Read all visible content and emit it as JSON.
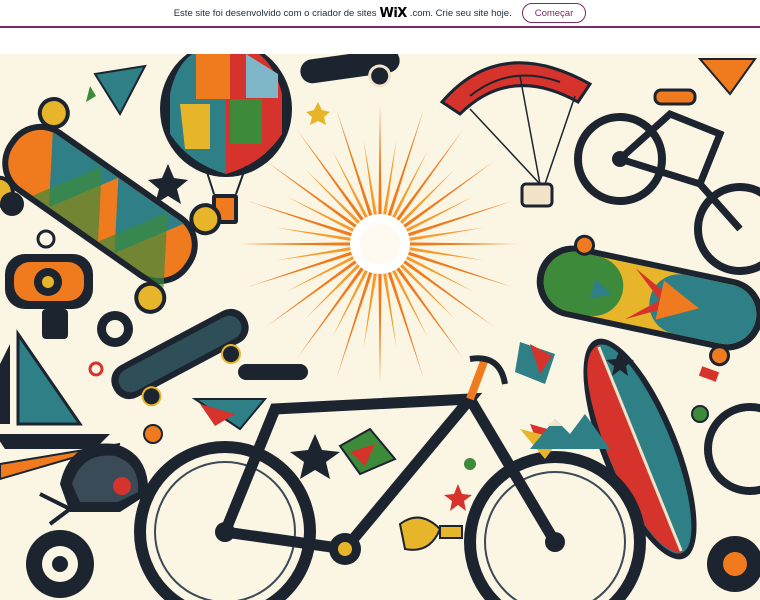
{
  "banner": {
    "text_before": "Este site foi desenvolvido com o criador de sites",
    "logo": "WiX",
    "text_after": ".com. Crie seu site hoje.",
    "button_label": "Começar",
    "accent": "#7b2a66"
  },
  "artwork": {
    "icons": [
      "sun-icon",
      "hot-air-balloon-icon",
      "paraglider-icon",
      "bicycle-icon",
      "skateboard-icon",
      "surfboard-icon",
      "sailboat-icon",
      "helmet-icon",
      "kite-icon"
    ],
    "colors": {
      "background": "#fbf6e4",
      "orange": "#f07a1e",
      "teal": "#2f7f86",
      "red": "#d5332b",
      "green": "#3c8a3a",
      "dark": "#1c2430"
    }
  }
}
